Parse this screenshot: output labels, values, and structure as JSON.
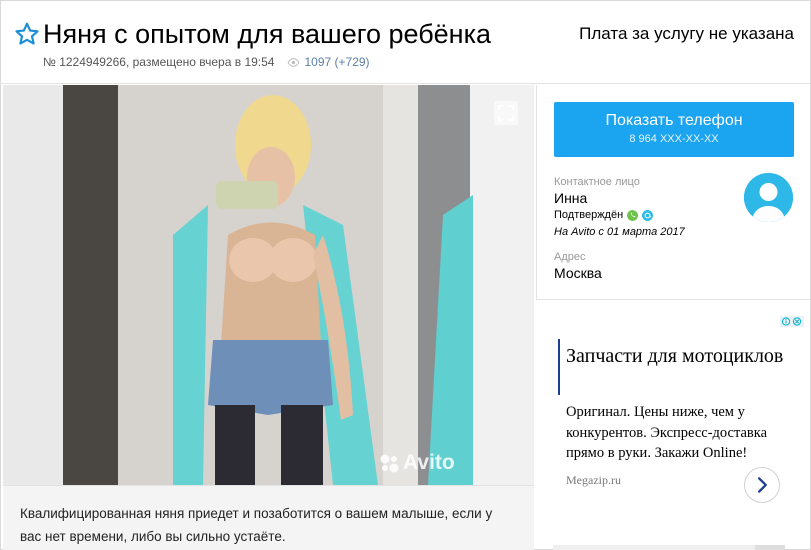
{
  "listing": {
    "title": "Няня с опытом для вашего ребёнка",
    "price_text": "Плата за услугу не указана",
    "meta_text": "№ 1224949266, размещено вчера в 19:54",
    "views": "1097 (+729)",
    "description": "Квалифицированная няня приедет и позаботится о вашем малыше, если у вас нет времени, либо вы сильно устаёте.",
    "photo_watermark": "Avito"
  },
  "contact": {
    "phone_button_label": "Показать телефон",
    "phone_masked": "8 964 XXX-XX-XX",
    "contact_label": "Контактное лицо",
    "name": "Инна",
    "verified_label": "Подтверждён",
    "since": "На Avito с 01 марта 2017",
    "address_label": "Адрес",
    "address": "Москва"
  },
  "ad": {
    "title": "Запчасти для мотоциклов",
    "text": "Оригинал. Цены ниже, чем у конкурентов. Экспресс-доставка прямо в руки. Закажи Online!",
    "domain": "Megazip.ru"
  },
  "icons": {
    "favorite": "star-outline-icon",
    "views": "eye-icon",
    "expand": "fullscreen-icon",
    "avatar": "user-avatar-icon",
    "phone_verified": "phone-icon",
    "email_verified": "email-icon",
    "ad_choices": "adchoices-icon",
    "ad_next": "chevron-right-icon"
  },
  "colors": {
    "accent": "#1ba4ef",
    "star": "#1a8fd8",
    "views_link": "#5b7fa6",
    "phone_green": "#6cc24a",
    "email_blue": "#2db8e8",
    "ad_bar": "#1d3f8f"
  }
}
